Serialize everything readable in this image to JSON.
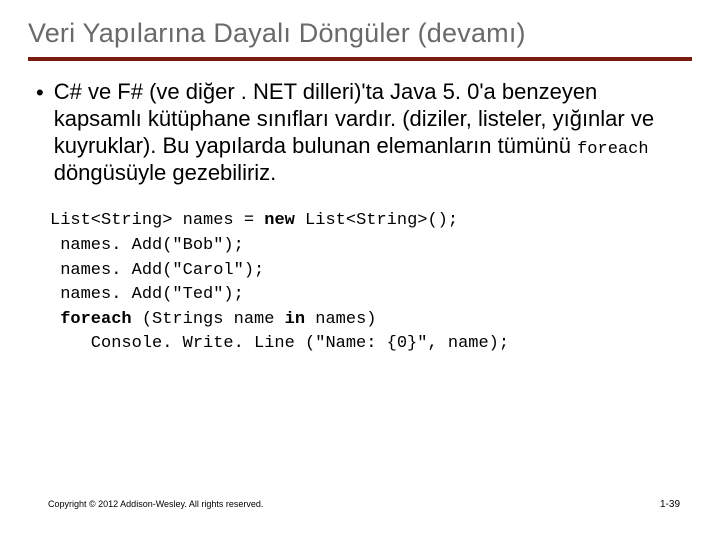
{
  "title": "Veri Yapılarına Dayalı Döngüler (devamı)",
  "bullet": {
    "pre": "C# ve F# (ve diğer . NET dilleri)'ta Java 5. 0'a benzeyen kapsamlı kütüphane sınıfları vardır.  (diziler, listeler, yığınlar ve kuyruklar). Bu yapılarda bulunan elemanların tümünü ",
    "kw": "foreach",
    "post": " döngüsüyle gezebiliriz."
  },
  "code": {
    "l1a": "List<String> names = ",
    "l1b": "new",
    "l1c": " List<String>();",
    "l2": " names. Add(\"Bob\");",
    "l3": " names. Add(\"Carol\");",
    "l4": " names. Add(\"Ted\");",
    "l5a": " ",
    "l5b": "foreach",
    "l5c": " (Strings name ",
    "l5d": "in",
    "l5e": " names)",
    "l6": "    Console. Write. Line (\"Name: {0}\", name);"
  },
  "footer": {
    "copyright": "Copyright © 2012 Addison-Wesley. All rights reserved.",
    "page": "1-39"
  }
}
